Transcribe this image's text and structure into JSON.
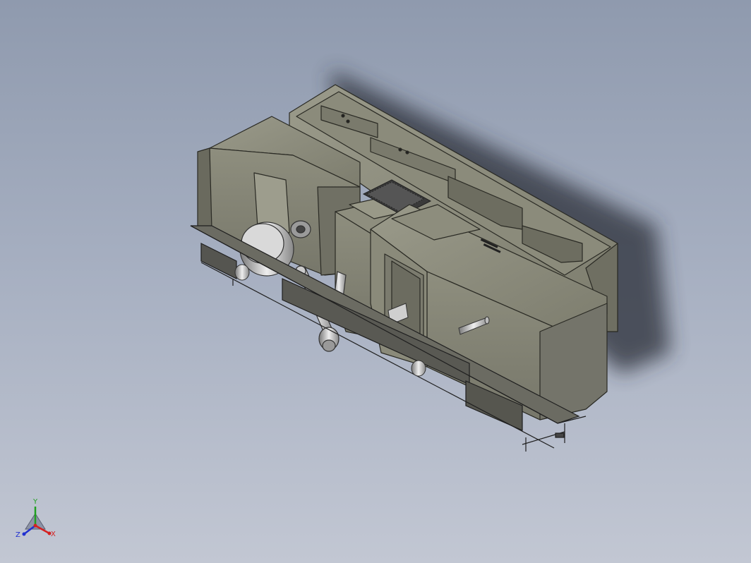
{
  "viewport": {
    "background_top": "#8f9aae",
    "background_bottom": "#c2c7d3",
    "model_color": "#8a8a7a",
    "metal_color": "#c9c9c9"
  },
  "triad": {
    "x_label": "X",
    "y_label": "Y",
    "z_label": "Z",
    "x_color": "#d42020",
    "y_color": "#20a020",
    "z_color": "#2030d0"
  }
}
